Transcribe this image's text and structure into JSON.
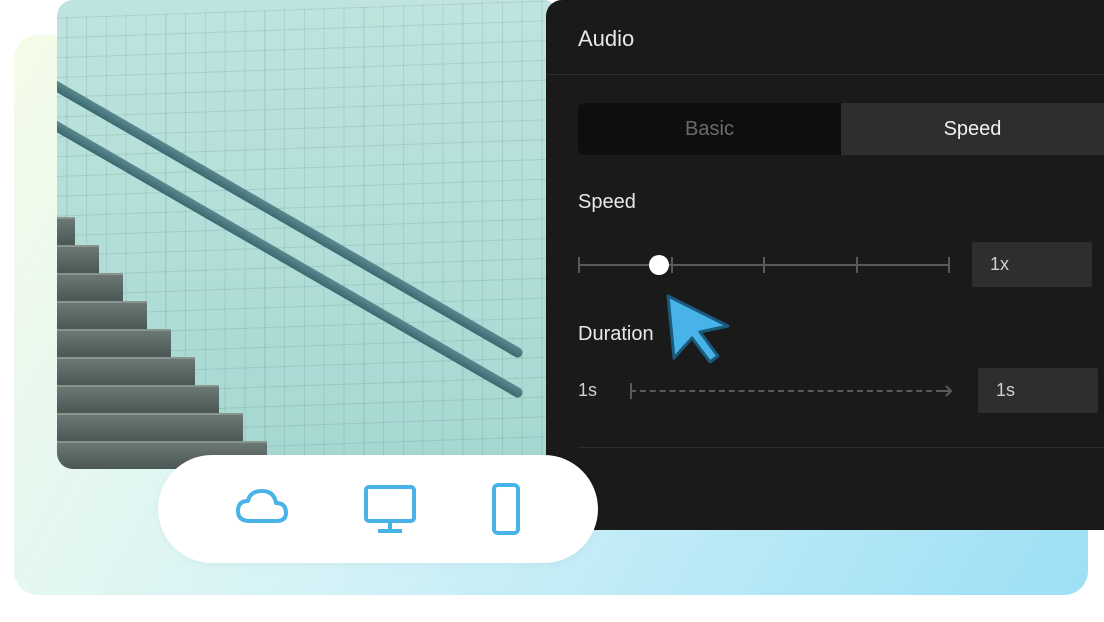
{
  "panel": {
    "title": "Audio",
    "tabs": [
      {
        "label": "Basic",
        "active": false
      },
      {
        "label": "Speed",
        "active": true
      }
    ],
    "speed": {
      "label": "Speed",
      "value_text": "1x",
      "thumb_position_percent": 22,
      "ticks_percent": [
        0,
        25,
        50,
        75,
        100
      ]
    },
    "duration": {
      "label": "Duration",
      "min_text": "1s",
      "value_text": "1s"
    }
  },
  "device_bar": {
    "items": [
      "cloud",
      "desktop",
      "phone"
    ]
  },
  "colors": {
    "accent": "#47b3e8",
    "panel_bg": "#1a1a1a"
  }
}
